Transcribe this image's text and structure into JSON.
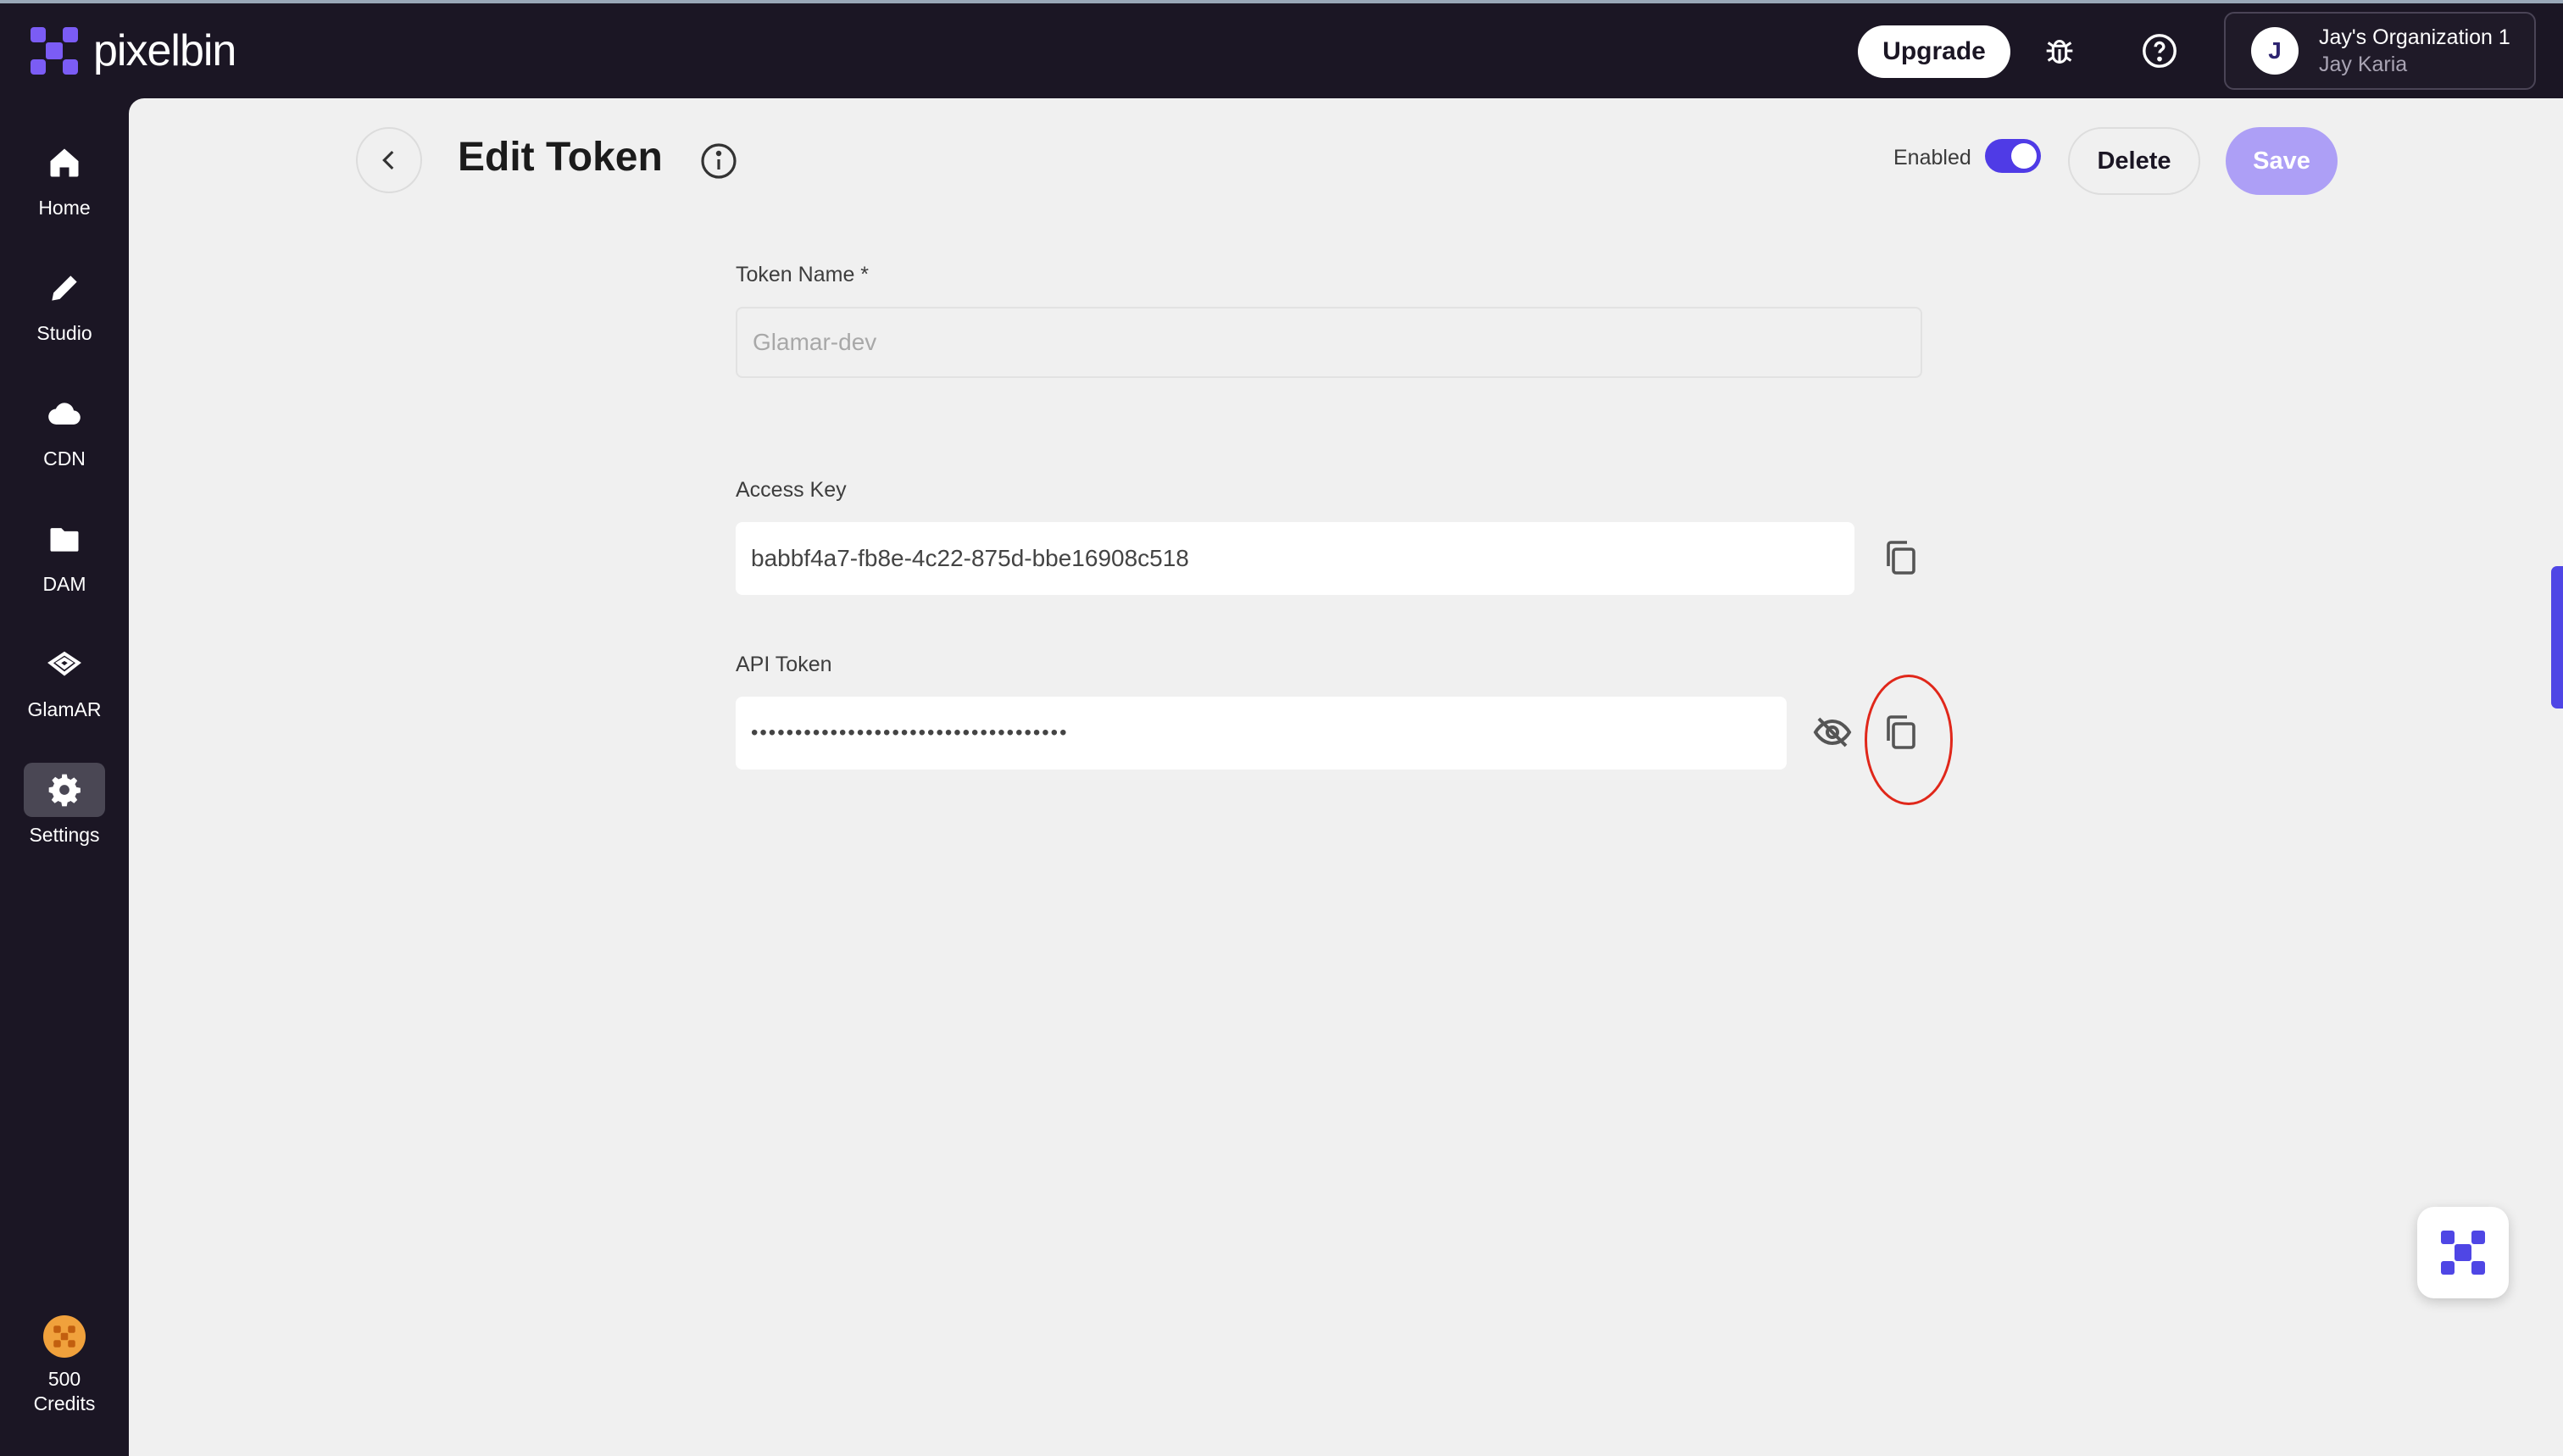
{
  "brand": {
    "name": "pixelbin",
    "accent": "#7b5cf5",
    "fab_accent": "#4f46e5"
  },
  "topbar": {
    "upgrade_label": "Upgrade",
    "bug_icon": "bug-icon",
    "help_icon": "help-circle-icon",
    "org": {
      "avatar_initial": "J",
      "name": "Jay's Organization 1",
      "user": "Jay Karia"
    }
  },
  "sidebar": {
    "items": [
      {
        "label": "Home",
        "icon": "home-icon"
      },
      {
        "label": "Studio",
        "icon": "pencil-icon"
      },
      {
        "label": "CDN",
        "icon": "cloud-icon"
      },
      {
        "label": "DAM",
        "icon": "folder-icon"
      },
      {
        "label": "GlamAR",
        "icon": "glamar-icon"
      },
      {
        "label": "Settings",
        "icon": "gear-icon",
        "active": true
      }
    ],
    "credits": {
      "amount": "500",
      "label": "Credits"
    }
  },
  "header": {
    "title": "Edit Token",
    "enabled_label": "Enabled",
    "enabled": true,
    "delete_label": "Delete",
    "save_label": "Save"
  },
  "form": {
    "token_name": {
      "label": "Token Name *",
      "placeholder": "Glamar-dev"
    },
    "access_key": {
      "label": "Access Key",
      "value": "babbf4a7-fb8e-4c22-875d-bbe16908c518"
    },
    "api_token": {
      "label": "API Token",
      "value": "••••••••••••••••••••••••••••••••••••"
    }
  },
  "colors": {
    "highlight_ring": "#e0271a",
    "toggle_on": "#4f3be6",
    "save_button": "#ad9ff6"
  }
}
